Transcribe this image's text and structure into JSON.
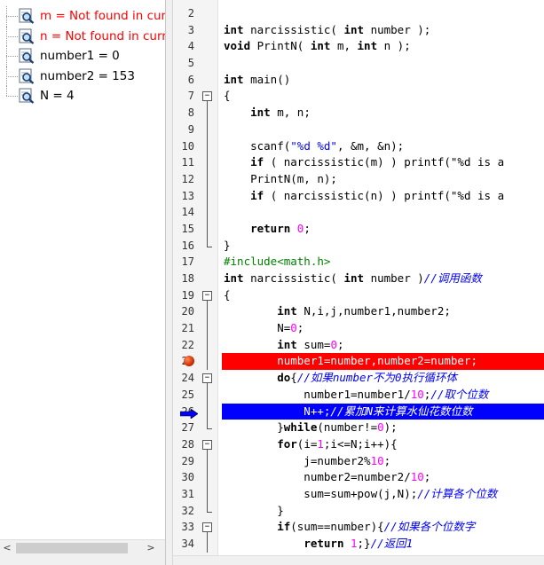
{
  "watch": {
    "items": [
      {
        "text": "m = Not found in current context",
        "state": "error",
        "icon": "watch-magnifier-icon"
      },
      {
        "text": "n = Not found in current context",
        "state": "error",
        "icon": "watch-magnifier-icon"
      },
      {
        "text": "number1 = 0",
        "state": "ok",
        "icon": "watch-magnifier-icon"
      },
      {
        "text": "number2 = 153",
        "state": "ok",
        "icon": "watch-magnifier-icon"
      },
      {
        "text": "N = 4",
        "state": "ok",
        "icon": "watch-magnifier-icon"
      }
    ],
    "scroll_left": "<",
    "scroll_right": ">"
  },
  "editor": {
    "lines": [
      {
        "n": "2",
        "fold": "",
        "code": ""
      },
      {
        "n": "3",
        "fold": "",
        "code": "int narcissistic( int number );"
      },
      {
        "n": "4",
        "fold": "",
        "code": "void PrintN( int m, int n );"
      },
      {
        "n": "5",
        "fold": "",
        "code": ""
      },
      {
        "n": "6",
        "fold": "",
        "code": "int main()"
      },
      {
        "n": "7",
        "fold": "open",
        "code": "{"
      },
      {
        "n": "8",
        "fold": "body",
        "code": "    int m, n;"
      },
      {
        "n": "9",
        "fold": "body",
        "code": ""
      },
      {
        "n": "10",
        "fold": "body",
        "code": "    scanf(\"%d %d\", &m, &n);"
      },
      {
        "n": "11",
        "fold": "body",
        "code": "    if ( narcissistic(m) ) printf(\"%d is a"
      },
      {
        "n": "12",
        "fold": "body",
        "code": "    PrintN(m, n);"
      },
      {
        "n": "13",
        "fold": "body",
        "code": "    if ( narcissistic(n) ) printf(\"%d is a"
      },
      {
        "n": "14",
        "fold": "body",
        "code": ""
      },
      {
        "n": "15",
        "fold": "body",
        "code": "    return 0;"
      },
      {
        "n": "16",
        "fold": "end",
        "code": "}"
      },
      {
        "n": "17",
        "fold": "",
        "code": "#include<math.h>"
      },
      {
        "n": "18",
        "fold": "",
        "code": "int narcissistic( int number )//调用函数"
      },
      {
        "n": "19",
        "fold": "open",
        "code": "{"
      },
      {
        "n": "20",
        "fold": "body",
        "code": "        int N,i,j,number1,number2;"
      },
      {
        "n": "21",
        "fold": "body",
        "code": "        N=0;"
      },
      {
        "n": "22",
        "fold": "body",
        "code": "        int sum=0;"
      },
      {
        "n": "23",
        "fold": "body",
        "code": "        number1=number,number2=number;",
        "mark": "breakpoint"
      },
      {
        "n": "24",
        "fold": "open",
        "code": "        do{//如果number不为0执行循环体"
      },
      {
        "n": "25",
        "fold": "body",
        "code": "            number1=number1/10;//取个位数"
      },
      {
        "n": "26",
        "fold": "body",
        "code": "            N++;//累加N来计算水仙花数位数",
        "mark": "exec"
      },
      {
        "n": "27",
        "fold": "end",
        "code": "        }while(number!=0);"
      },
      {
        "n": "28",
        "fold": "open",
        "code": "        for(i=1;i<=N;i++){"
      },
      {
        "n": "29",
        "fold": "body",
        "code": "            j=number2%10;"
      },
      {
        "n": "30",
        "fold": "body",
        "code": "            number2=number2/10;"
      },
      {
        "n": "31",
        "fold": "body",
        "code": "            sum=sum+pow(j,N);//计算各个位数"
      },
      {
        "n": "32",
        "fold": "end",
        "code": "        }"
      },
      {
        "n": "33",
        "fold": "open",
        "code": "        if(sum==number){//如果各个位数字"
      },
      {
        "n": "34",
        "fold": "body",
        "code": "            return 1;}//返回1"
      }
    ]
  },
  "colors": {
    "breakpoint_bg": "#ff0000",
    "exec_bg": "#0000ff",
    "error_text": "#ff0000",
    "comment": "#0000ff",
    "preprocessor": "#008000",
    "number": "#ff00ff"
  }
}
